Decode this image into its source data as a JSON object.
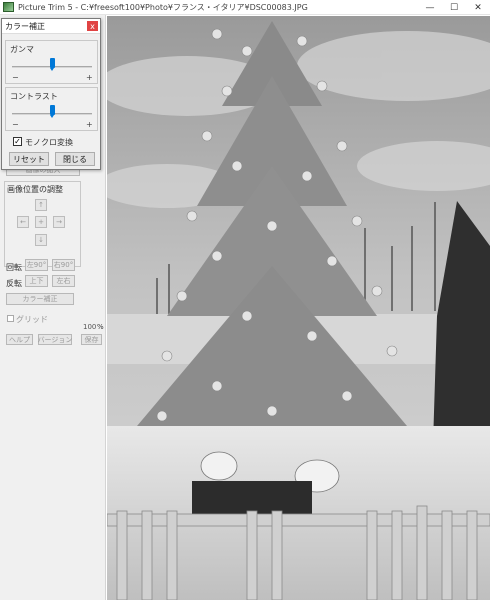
{
  "window": {
    "title": "Picture Trim 5 - C:¥freesoft100¥Photo¥フランス・イタリア¥DSC00083.JPG",
    "controls": {
      "minimize": "—",
      "maximize": "☐",
      "close": "✕"
    }
  },
  "left_panel": {
    "resize_button": "画像の拡大",
    "position_group_label": "画像位置の調整",
    "arrows": {
      "up": "↑",
      "left": "←",
      "center": "+",
      "right": "→",
      "down": "↓"
    },
    "rotate_label": "回転",
    "rotate_left": "左90°",
    "rotate_right": "右90°",
    "flip_label": "反転",
    "flip_vertical": "上下",
    "flip_horizontal": "左右",
    "color_correct_button": "カラー補正",
    "grid_label": "グリッド",
    "zoom_value": "100",
    "zoom_unit": "%",
    "help_button": "ヘルプ",
    "version_button": "バージョン",
    "save_button": "保存"
  },
  "dialog": {
    "title": "カラー補正",
    "close": "x",
    "gamma_label": "ガンマ",
    "contrast_label": "コントラスト",
    "minus": "−",
    "plus": "+",
    "gamma_level": 0.5,
    "contrast_level": 0.5,
    "mono_label": "モノクロ変換",
    "mono_checked": true,
    "check_mark": "✓",
    "reset_button": "リセット",
    "close_button": "閉じる"
  }
}
